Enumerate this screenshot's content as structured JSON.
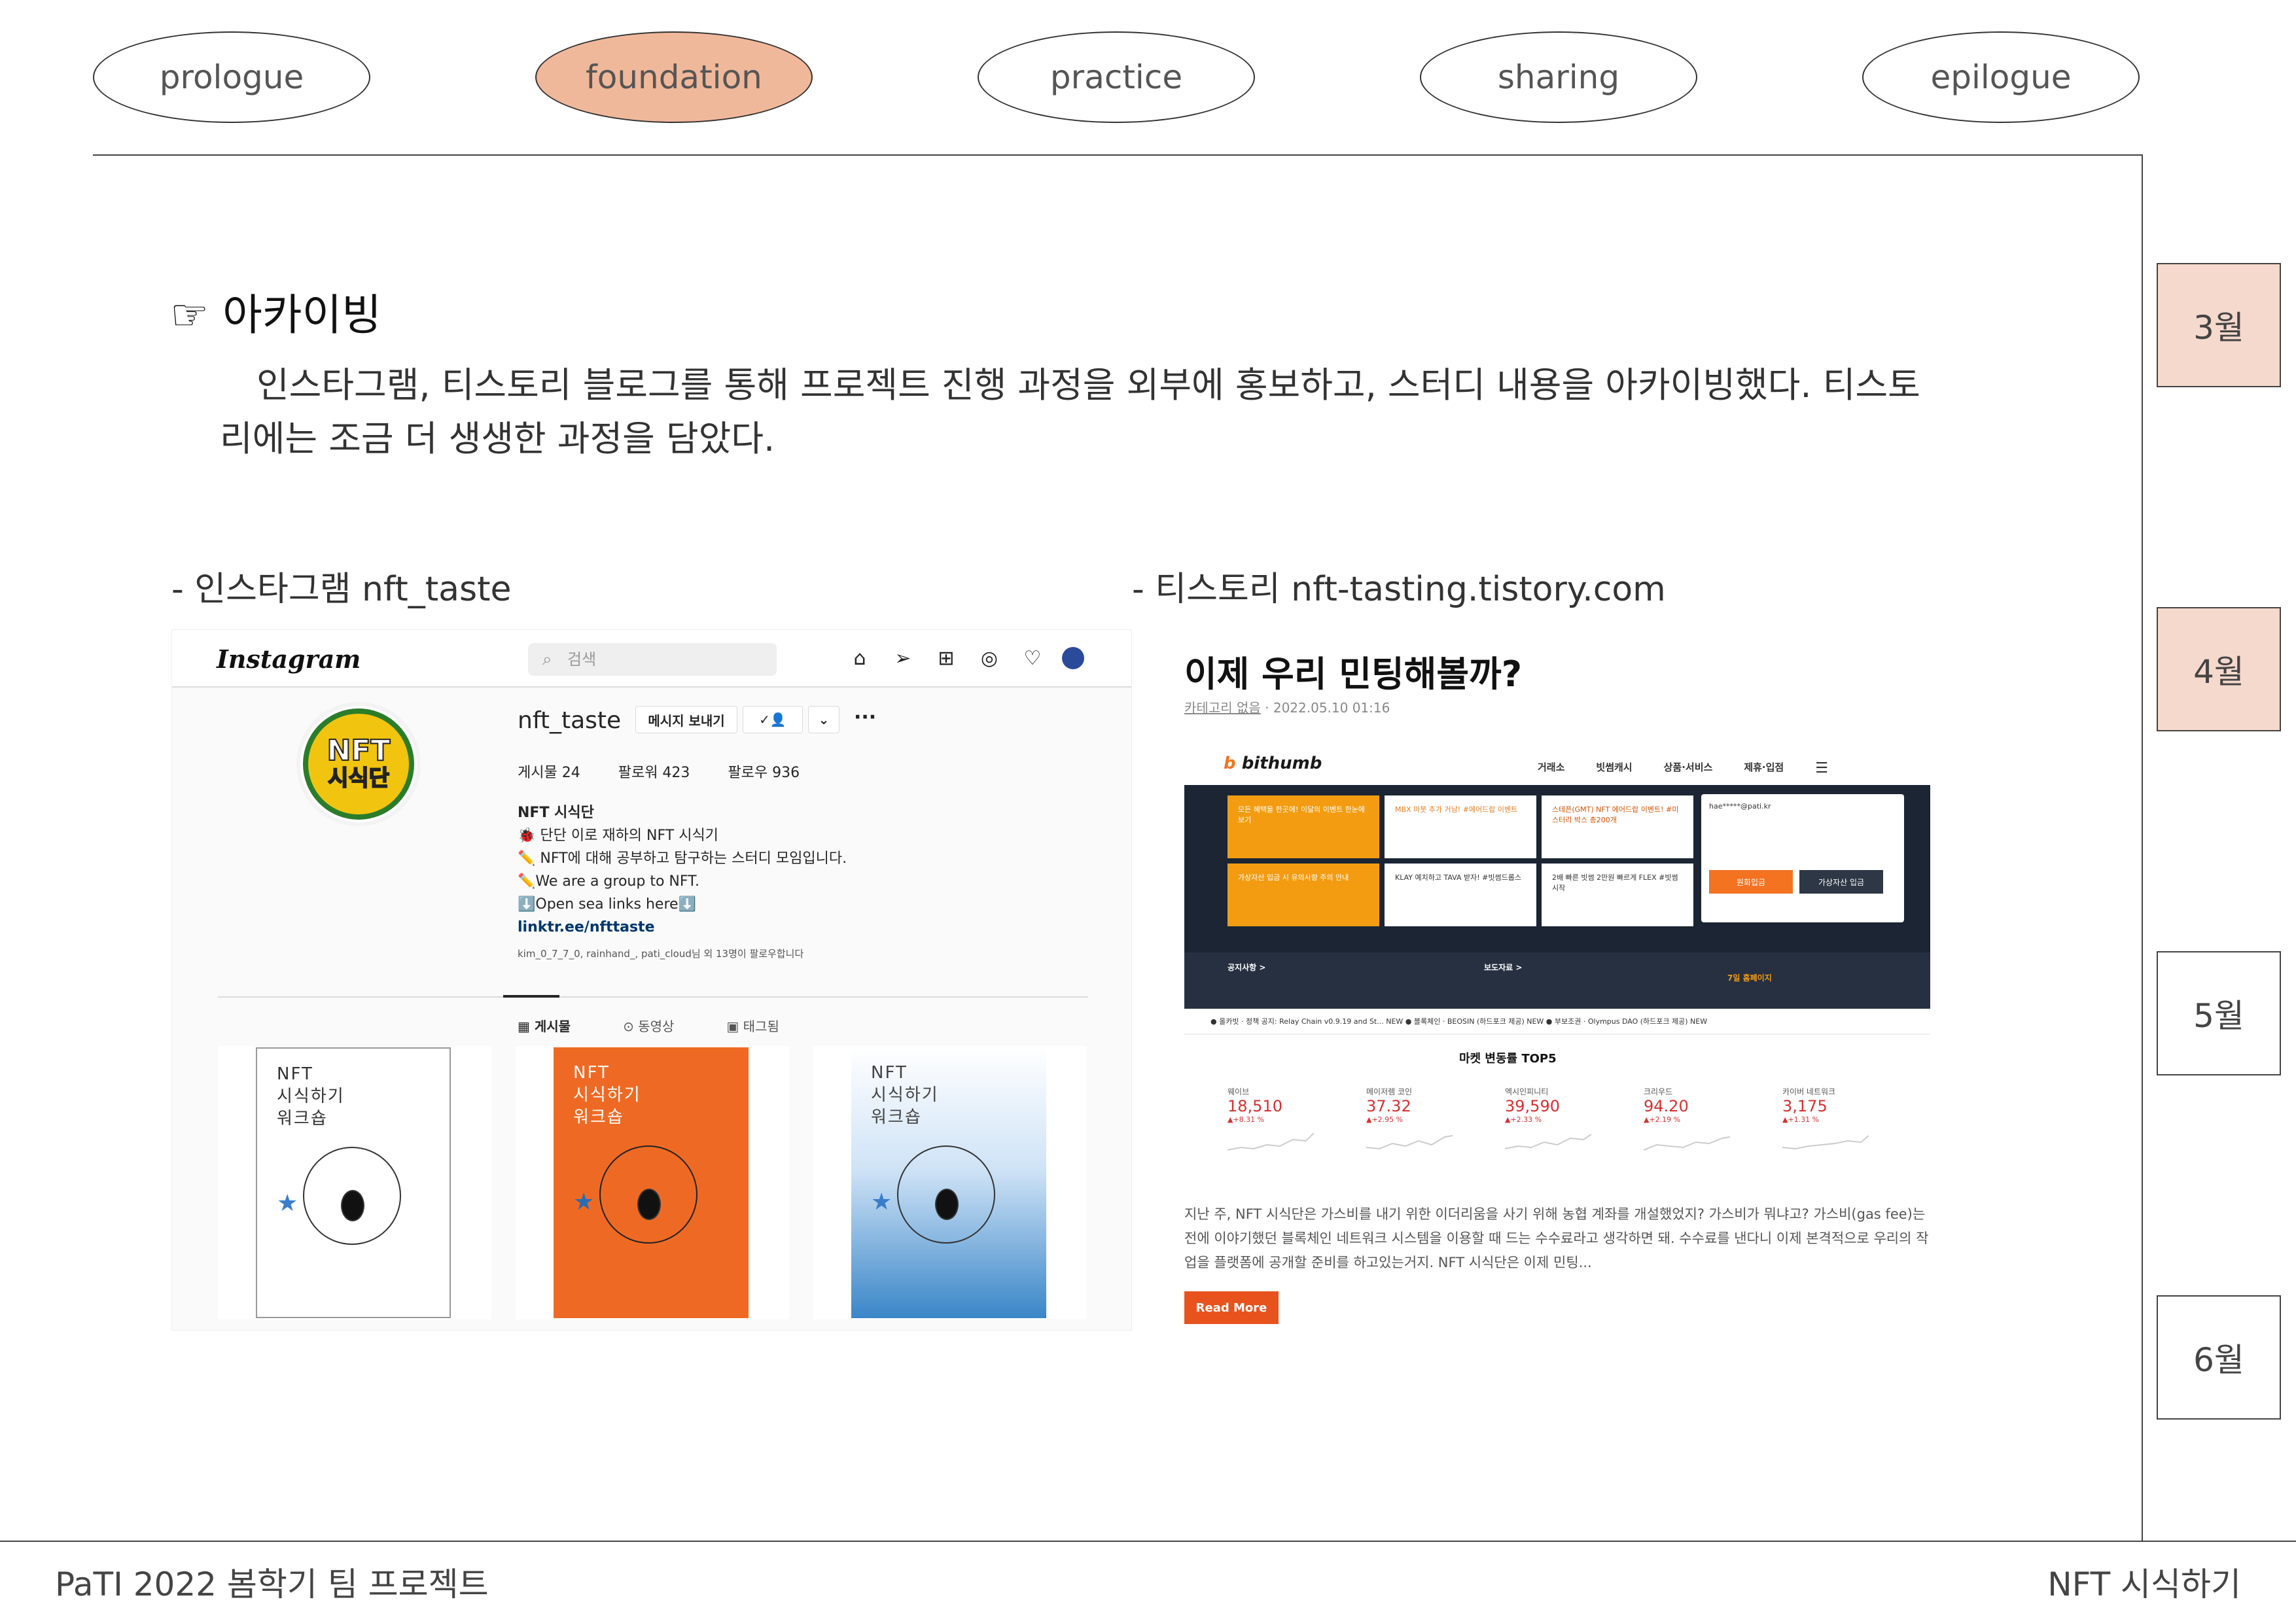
{
  "nav": [
    "prologue",
    "foundation",
    "practice",
    "sharing",
    "epilogue"
  ],
  "months": [
    "3월",
    "4월",
    "5월",
    "6월"
  ],
  "section": {
    "icon": "hand-pointing-icon",
    "title": "☞ 아카이빙",
    "paragraph": "인스타그램, 티스토리 블로그를 통해 프로젝트 진행 과정을 외부에 홍보하고, 스터디 내용을 아카이빙했다. 티스토리에는 조금 더 생생한 과정을 담았다."
  },
  "captions": {
    "instagram": "- 인스타그램 nft_taste",
    "tistory": "- 티스토리 nft-tasting.tistory.com"
  },
  "instagram": {
    "logo": "Instagram",
    "search_placeholder": "검색",
    "username": "nft_taste",
    "message_button": "메시지 보내기",
    "stats": [
      "게시물 24",
      "팔로워 423",
      "팔로우 936"
    ],
    "bio_name": "NFT 시식단",
    "bio_lines": [
      "🐞 단단 이로 재하의 NFT 시식기",
      "✏️ NFT에 대해 공부하고 탐구하는 스터디 모임입니다.",
      "✏️We are a group to NFT.",
      "⬇️Open sea links here⬇️"
    ],
    "bio_link": "linktr.ee/nfttaste",
    "followed_by": "kim_0_7_7_0, rainhand_, pati_cloud님 외 13명이 팔로우합니다",
    "tabs": [
      "▦ 게시물",
      "⊙ 동영상",
      "▣ 태그됨"
    ],
    "poster_text": [
      "NFT",
      "시식하기",
      "워크숍"
    ],
    "poster_colors": [
      "#ffffff",
      "#ee6a24",
      "#3a86c8"
    ]
  },
  "tistory": {
    "title": "이제 우리 민팅해볼까?",
    "meta_category": "카테고리 없음",
    "meta_date": " · 2022.05.10 01:16",
    "bithumb": {
      "logo": "bithumb",
      "nav": [
        "거래소",
        "빗썸캐시",
        "상품·서비스",
        "제휴·입점"
      ],
      "cards": [
        "모든 혜택을 한곳에! 이달의 이벤트 한눈에 보기",
        "MBX 마붓 추가 거남! #에어드랍 이벤트",
        "스테픈(GMT) NFT 에어드랍 이벤트! #미스터리 박스 총200개",
        "가상자산 입금 시 유의사항 주의 안내",
        "KLAY 예치하고 TAVA 받자! #빗썸드롭스",
        "2배 빠른 빗썸 2만원 빠르게 FLEX #빗썸 시작"
      ],
      "login_email": "hae*****@pati.kr",
      "login_btn1": "원화입금",
      "login_btn2": "가상자산 입금",
      "news_left_title": "공지사항 >",
      "news_mid_title": "보도자료 >",
      "news_right": "7일 홈페이지",
      "ticker": "● 올카빗 · 정책 공지: Relay Chain v0.9.19 and St... NEW    ● 블록체인 · BEOSIN (하드포크 제공) NEW    ● 부보조권 · Olympus DAO (하드포크 제공) NEW",
      "market_title": "마켓 변동률 TOP5",
      "market": [
        {
          "name": "웨이브",
          "value": "18,510",
          "change": "▲+8.31 %"
        },
        {
          "name": "메이저렘 코인",
          "value": "37.32",
          "change": "▲+2.95 %"
        },
        {
          "name": "엑시인피니티",
          "value": "39,590",
          "change": "▲+2.33 %"
        },
        {
          "name": "크리우드",
          "value": "94.20",
          "change": "▲+2.19 %"
        },
        {
          "name": "카이버 네트워크",
          "value": "3,175",
          "change": "▲+1.31 %"
        }
      ]
    },
    "body": "지난 주, NFT 시식단은 가스비를 내기 위한 이더리움을 사기 위해 농협 계좌를 개설했었지? 가스비가 뭐냐고? 가스비(gas fee)는 전에 이야기했던 블록체인 네트워크 시스템을 이용할 때 드는 수수료라고 생각하면 돼. 수수료를 낸다니 이제 본격적으로 우리의 작업을 플랫폼에 공개할 준비를 하고있는거지. NFT 시식단은 이제 민팅...",
    "read_more": "Read More"
  },
  "footer": {
    "left": "PaTI 2022 봄학기 팀 프로젝트",
    "right": "NFT 시식하기"
  },
  "colors": {
    "active_nav": "#f0b89a",
    "month_highlight": "#f5d9cc",
    "read_more": "#e8531d"
  }
}
